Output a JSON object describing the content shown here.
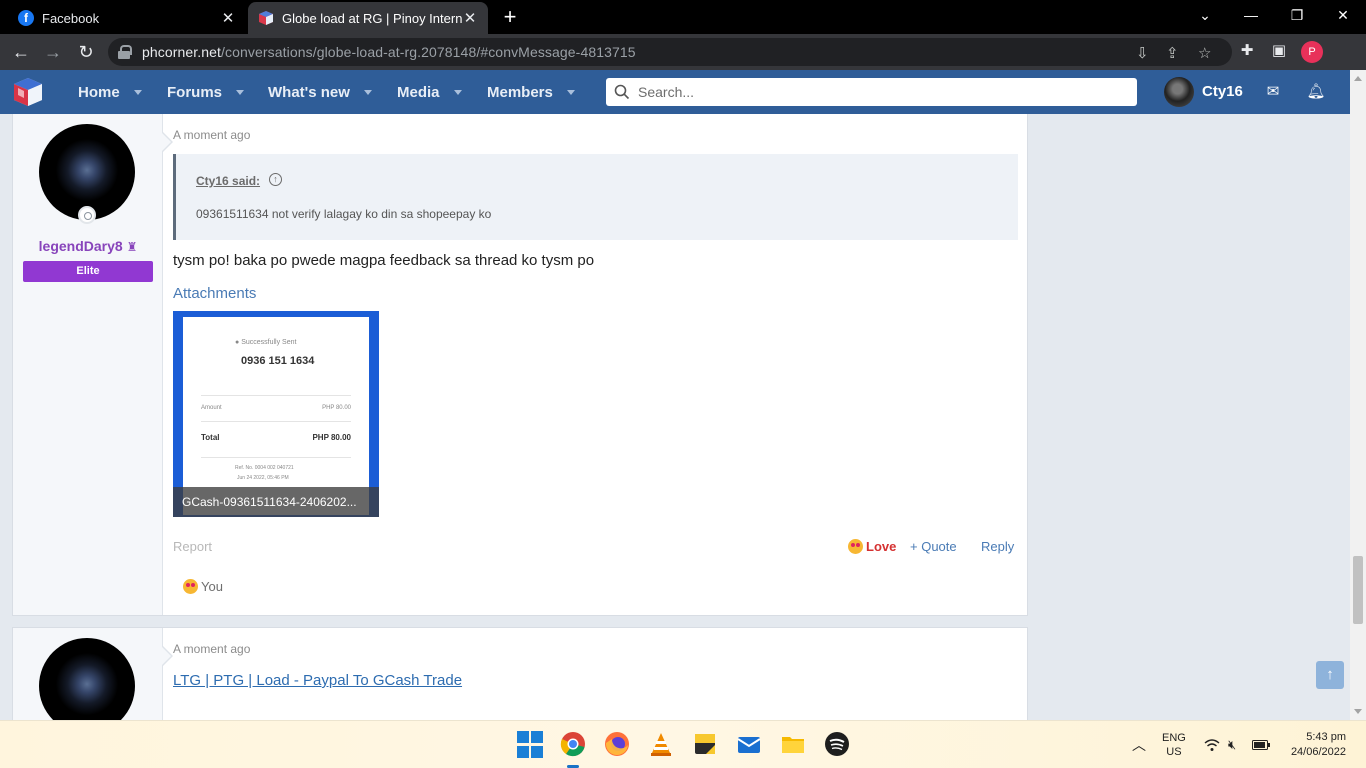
{
  "browser": {
    "tabs": [
      {
        "title": "Facebook",
        "icon": "facebook-icon"
      },
      {
        "title": "Globe load at RG | Pinoy Internet",
        "icon": "phcorner-icon"
      }
    ],
    "new_tab": "+",
    "close_glyph": "✕",
    "address": {
      "host": "phcorner.net",
      "path": "/conversations/globe-load-at-rg.2078148/#convMessage-4813715"
    },
    "profile_initial": "P"
  },
  "site": {
    "nav": [
      {
        "label": "Home"
      },
      {
        "label": "Forums"
      },
      {
        "label": "What's new"
      },
      {
        "label": "Media"
      },
      {
        "label": "Members"
      }
    ],
    "search_placeholder": "Search...",
    "user_name": "Cty16"
  },
  "messages": [
    {
      "time": "A moment ago",
      "author": "legendDary8",
      "badge": "Elite",
      "quote": {
        "author": "Cty16 said:",
        "text": "09361511634 not verify lalagay ko din sa shopeepay ko"
      },
      "body": "tysm po! baka po pwede magpa feedback sa thread ko tysm po",
      "attachments_title": "Attachments",
      "attachment": {
        "filename": "GCash-09361511634-2406202...",
        "receipt": {
          "status": "Successfully Sent",
          "number": "0936 151 1634",
          "amount_label": "Amount",
          "amount_value": "PHP 80.00",
          "total_label": "Total",
          "total_value": "PHP 80.00",
          "ref": "Ref. No. 0004 002 040721",
          "date": "Jun 24 2022, 05:46 PM"
        }
      },
      "actions": {
        "report": "Report",
        "love": "Love",
        "quote": "+ Quote",
        "reply": "Reply"
      },
      "reactions": "You"
    },
    {
      "time": "A moment ago",
      "link": "LTG | PTG | Load - Paypal To GCash Trade"
    }
  ],
  "taskbar": {
    "lang": "ENG",
    "region": "US",
    "time": "5:43 pm",
    "date": "24/06/2022"
  },
  "colors": {
    "header": "#2f5d98",
    "accent_link": "#4a7bb5",
    "username": "#8844bb",
    "badge": "#9138d2",
    "love": "#d53131"
  }
}
